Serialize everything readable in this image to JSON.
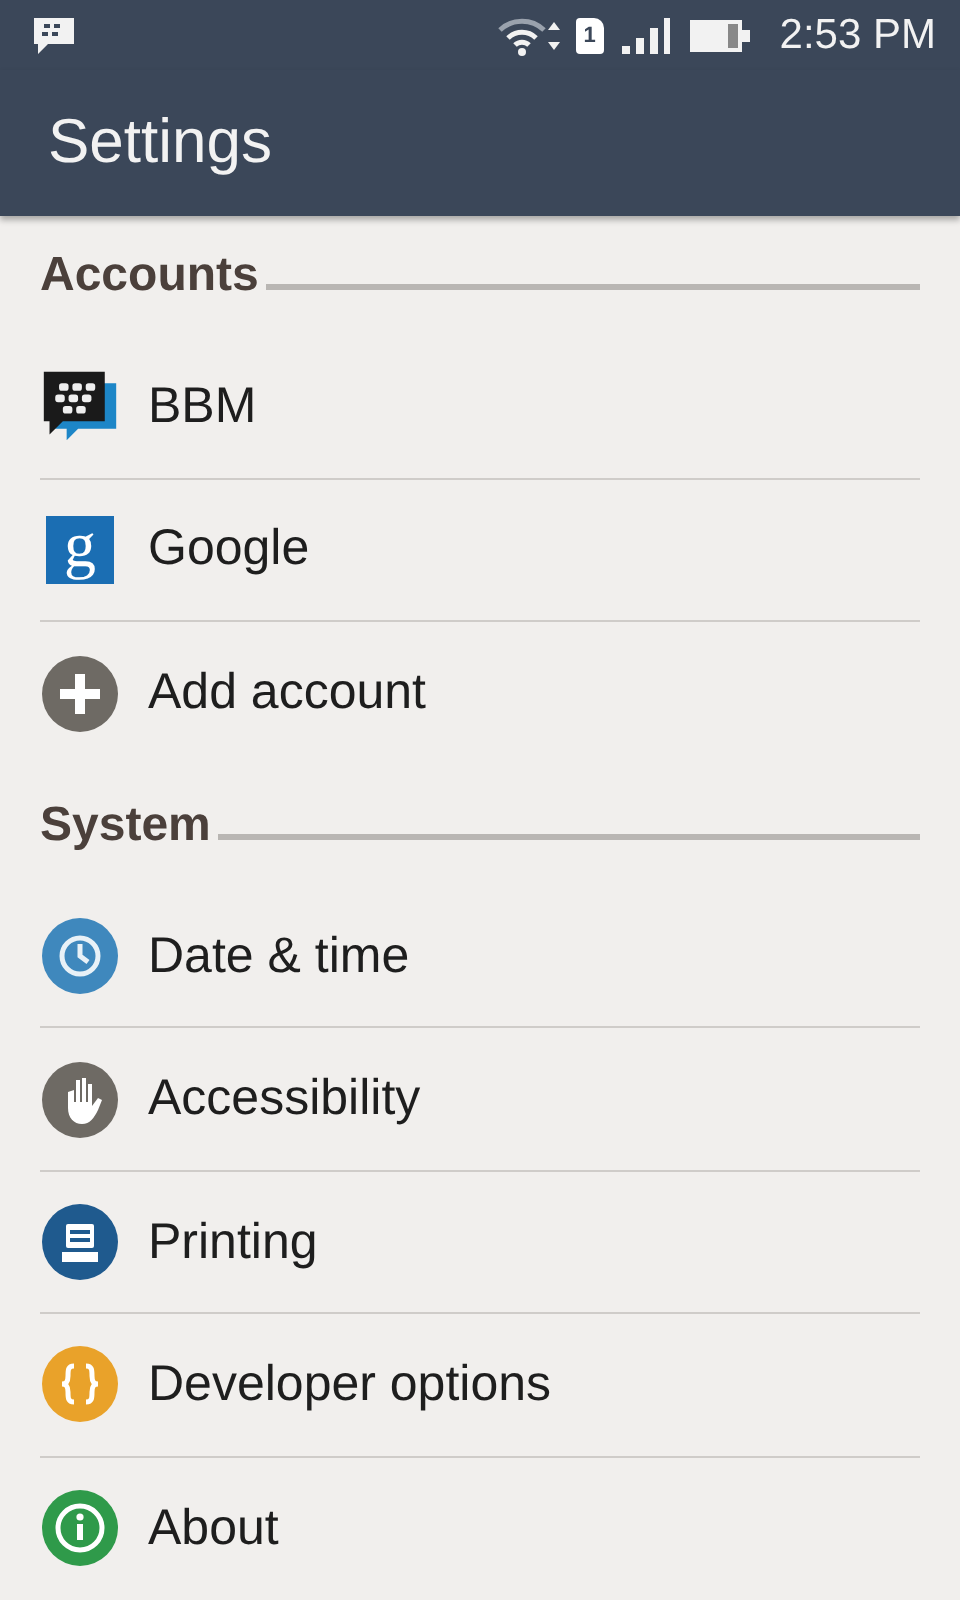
{
  "status_bar": {
    "sim_slot": "1",
    "time": "2:53 PM"
  },
  "app_bar": {
    "title": "Settings"
  },
  "sections": [
    {
      "title": "Accounts",
      "items": [
        {
          "label": "BBM",
          "kind": "bbm"
        },
        {
          "label": "Google",
          "kind": "google",
          "logo_letter": "g"
        },
        {
          "label": "Add account",
          "kind": "add"
        }
      ]
    },
    {
      "title": "System",
      "items": [
        {
          "label": "Date & time",
          "kind": "clock"
        },
        {
          "label": "Accessibility",
          "kind": "hand"
        },
        {
          "label": "Printing",
          "kind": "printer"
        },
        {
          "label": "Developer options",
          "kind": "braces"
        },
        {
          "label": "About",
          "kind": "info"
        }
      ]
    }
  ]
}
